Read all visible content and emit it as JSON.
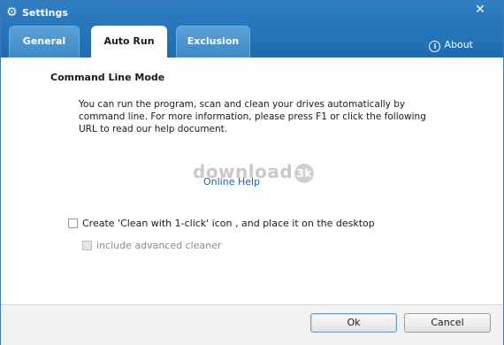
{
  "window": {
    "title": "Settings",
    "title_icon": "gear-icon",
    "close_glyph": "✕"
  },
  "tabs": [
    {
      "label": "General",
      "active": false
    },
    {
      "label": "Auto Run",
      "active": true
    },
    {
      "label": "Exclusion",
      "active": false
    }
  ],
  "about": {
    "label": "About",
    "icon": "info-icon"
  },
  "section": {
    "title": "Command Line Mode",
    "description": "You can run the program, scan and clean your drives automatically by command line. For more information, please press F1 or click the following URL to read our help document."
  },
  "watermark": {
    "text": "download",
    "badge": "3k"
  },
  "online_help": {
    "label": "Online Help"
  },
  "options": {
    "create_shortcut": {
      "label": "Create 'Clean with 1-click' icon , and place it on the desktop",
      "checked": false
    },
    "include_advanced": {
      "label": "include advanced cleaner",
      "checked": false,
      "disabled": true
    }
  },
  "buttons": {
    "ok": "Ok",
    "cancel": "Cancel"
  },
  "colors": {
    "header_blue": "#1e6bb1",
    "link_blue": "#1f5fa8"
  }
}
